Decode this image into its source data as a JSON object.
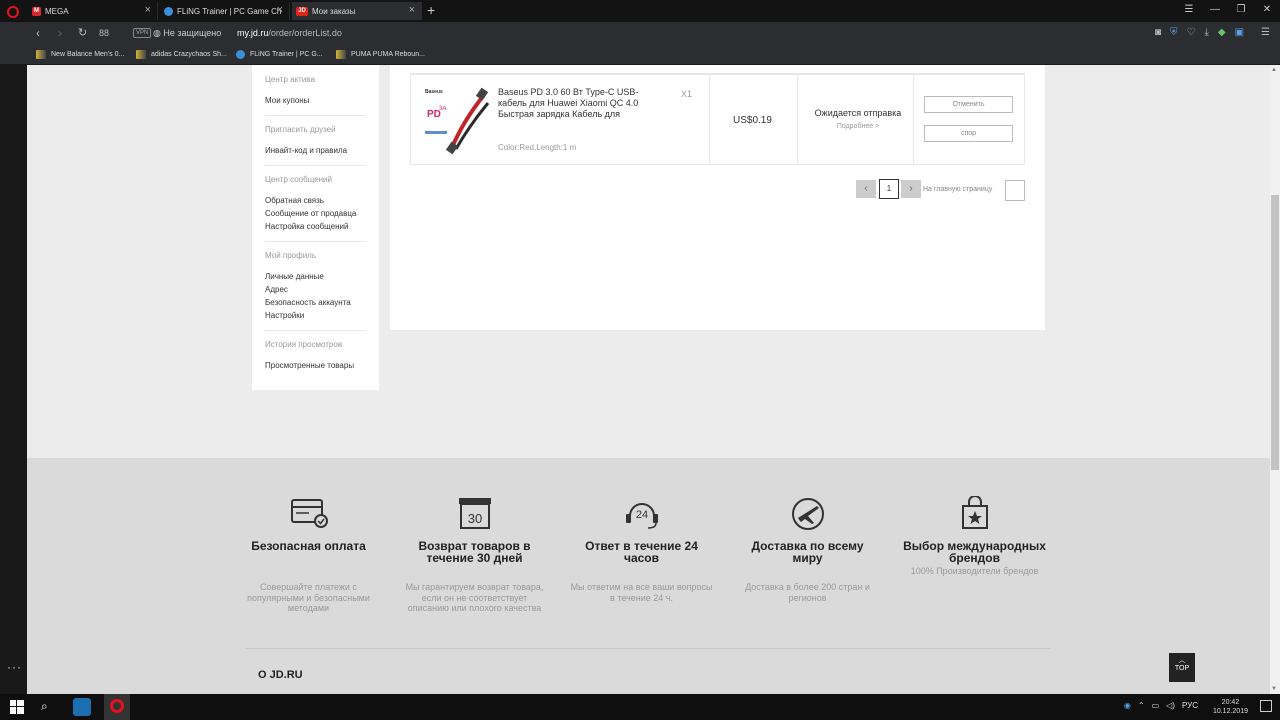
{
  "browser": {
    "tabs": [
      {
        "title": "MEGA",
        "fav_text": "M",
        "fav_color": "#d9272e"
      },
      {
        "title": "FLiNG Trainer | PC Game Che",
        "fav_text": "",
        "fav_color": "#3b8fd6"
      },
      {
        "title": "Мои заказы",
        "fav_text": "JD",
        "fav_color": "#e1251b"
      }
    ],
    "vpn_label": "VPN",
    "security_label": "Не защищено",
    "url_domain": "my.jd.ru",
    "url_path": "/order/orderList.do",
    "bookmarks": [
      "New Balance Men's 0...",
      "adidas Crazychaos Sh...",
      "FLiNG Trainer | PC G...",
      "PUMA PUMA Reboun..."
    ]
  },
  "sidebar": {
    "groups": [
      {
        "title": "Центр актива",
        "items": [
          "Мои купоны"
        ]
      },
      {
        "title": "Пригласить друзей",
        "items": [
          "Инвайт-код и правила"
        ]
      },
      {
        "title": "Центр сообщений",
        "items": [
          "Обратная связь",
          "Сообщение от продавца",
          "Настройка сообщений"
        ]
      },
      {
        "title": "Мой профиль",
        "items": [
          "Личные данные",
          "Адрес",
          "Безопасность аккаунта",
          "Настройки"
        ]
      },
      {
        "title": "История просмотров",
        "items": [
          "Просмотренные товары"
        ]
      }
    ]
  },
  "order": {
    "product_name": "Baseus PD 3.0 60 Вт Type-C USB-кабель для Huawei Xiaomi QC 4.0 Быстрая зарядка Кабель для",
    "quantity": "X1",
    "attributes": "Color:Red,Length:1 m",
    "price": "US$0.19",
    "status": "Ожидается отправка",
    "detail_link": "Подробнее >",
    "cancel_label": "Отменить",
    "dispute_label": "спор",
    "image_brand": "Baseus",
    "image_badge": "PD",
    "image_badge_sub": "3A"
  },
  "pagination": {
    "current_page": "1",
    "goto_label": "На главную страницу"
  },
  "footer": {
    "features": [
      {
        "icon": "card-icon",
        "title": "Безопасная оплата",
        "desc": "Совершайте платежи с популярными и безопасными методами"
      },
      {
        "icon": "calendar-30-icon",
        "title": "Возврат товаров в течение 30 дней",
        "desc": "Мы гарантируем возврат товара, если он не соответствует описанию или плохого качества",
        "icon_text": "30"
      },
      {
        "icon": "headset-24-icon",
        "title": "Ответ в течение 24 часов",
        "desc": "Мы ответим на все ваши вопросы в течение 24 ч.",
        "icon_text": "24"
      },
      {
        "icon": "plane-icon",
        "title": "Доставка по всему миру",
        "desc": "Доставка в более 200 стран и регионов"
      },
      {
        "icon": "shopping-bag-icon",
        "title": "Выбор международных брендов",
        "desc": "100% Производители брендов"
      }
    ],
    "about_title": "О JD.RU",
    "top_label": "TOP"
  },
  "taskbar": {
    "lang": "РУС",
    "time": "20:42",
    "date": "10.12.2019"
  }
}
